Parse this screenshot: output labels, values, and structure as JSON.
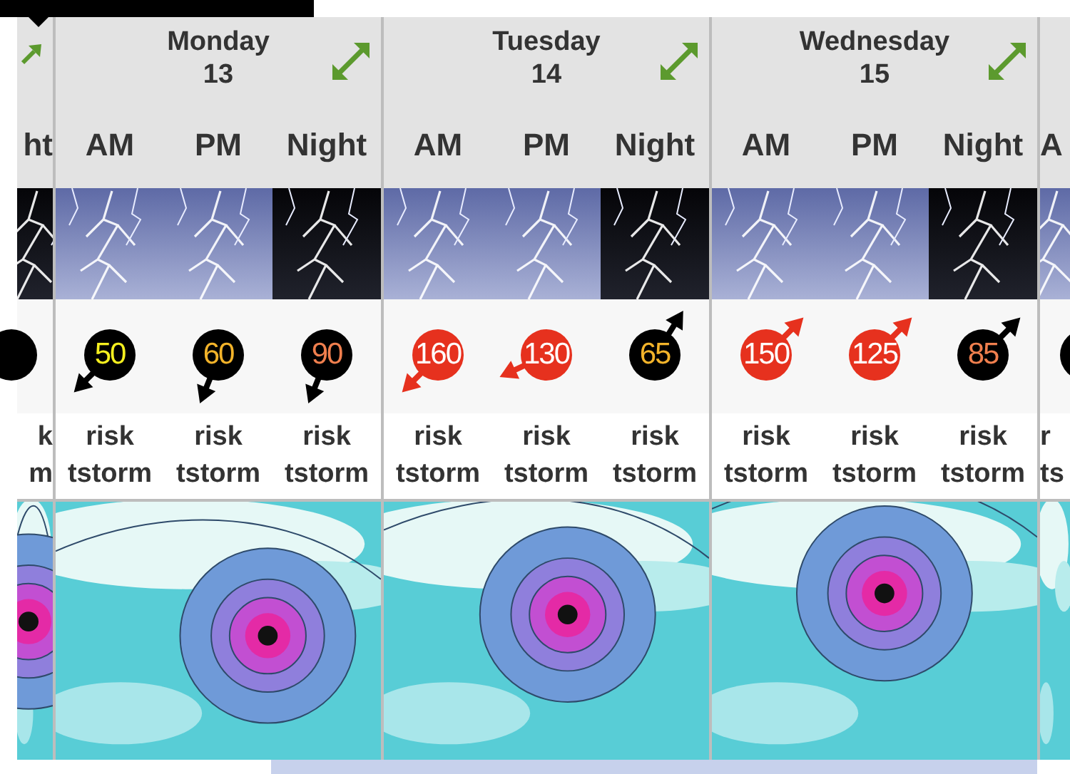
{
  "left_edge": {
    "period": "ht",
    "kind": "night",
    "condition": "k m"
  },
  "days": [
    {
      "name": "Monday",
      "date": "13",
      "periods": [
        {
          "label": "AM",
          "kind": "day",
          "marker": {
            "kind": "black"
          },
          "arrow": {
            "kind": "sw"
          },
          "wind": {
            "value": "50",
            "color": "#f5ef1f"
          },
          "condition": "risk tstorm"
        },
        {
          "label": "PM",
          "kind": "day",
          "marker": {
            "kind": "black"
          },
          "arrow": {
            "kind": "ssw"
          },
          "wind": {
            "value": "60",
            "color": "#f2b32a"
          },
          "condition": "risk tstorm"
        },
        {
          "label": "Night",
          "kind": "night",
          "marker": {
            "kind": "black"
          },
          "arrow": {
            "kind": "ssw"
          },
          "wind": {
            "value": "90",
            "color": "#f07f4e"
          },
          "condition": "risk tstorm"
        }
      ]
    },
    {
      "name": "Tuesday",
      "date": "14",
      "periods": [
        {
          "label": "AM",
          "kind": "day",
          "marker": {
            "kind": "red"
          },
          "arrow": {
            "kind": "sw"
          },
          "wind": {
            "value": "160",
            "color": "#ffffff"
          },
          "condition": "risk tstorm"
        },
        {
          "label": "PM",
          "kind": "day",
          "marker": {
            "kind": "red"
          },
          "arrow": {
            "kind": "wsw"
          },
          "wind": {
            "value": "130",
            "color": "#ffffff"
          },
          "condition": "risk tstorm"
        },
        {
          "label": "Night",
          "kind": "night",
          "marker": {
            "kind": "black"
          },
          "arrow": {
            "kind": "nne"
          },
          "wind": {
            "value": "65",
            "color": "#f2b32a"
          },
          "condition": "risk tstorm"
        }
      ]
    },
    {
      "name": "Wednesday",
      "date": "15",
      "periods": [
        {
          "label": "AM",
          "kind": "day",
          "marker": {
            "kind": "red"
          },
          "arrow": {
            "kind": "ne"
          },
          "wind": {
            "value": "150",
            "color": "#ffffff"
          },
          "condition": "risk tstorm"
        },
        {
          "label": "PM",
          "kind": "day",
          "marker": {
            "kind": "red"
          },
          "arrow": {
            "kind": "ne"
          },
          "wind": {
            "value": "125",
            "color": "#ffffff"
          },
          "condition": "risk tstorm"
        },
        {
          "label": "Night",
          "kind": "night",
          "marker": {
            "kind": "black"
          },
          "arrow": {
            "kind": "ne"
          },
          "wind": {
            "value": "85",
            "color": "#f07f4e"
          },
          "condition": "risk tstorm"
        }
      ]
    }
  ],
  "right_edge": {
    "period": "A",
    "kind": "day",
    "condition": "r ts"
  }
}
